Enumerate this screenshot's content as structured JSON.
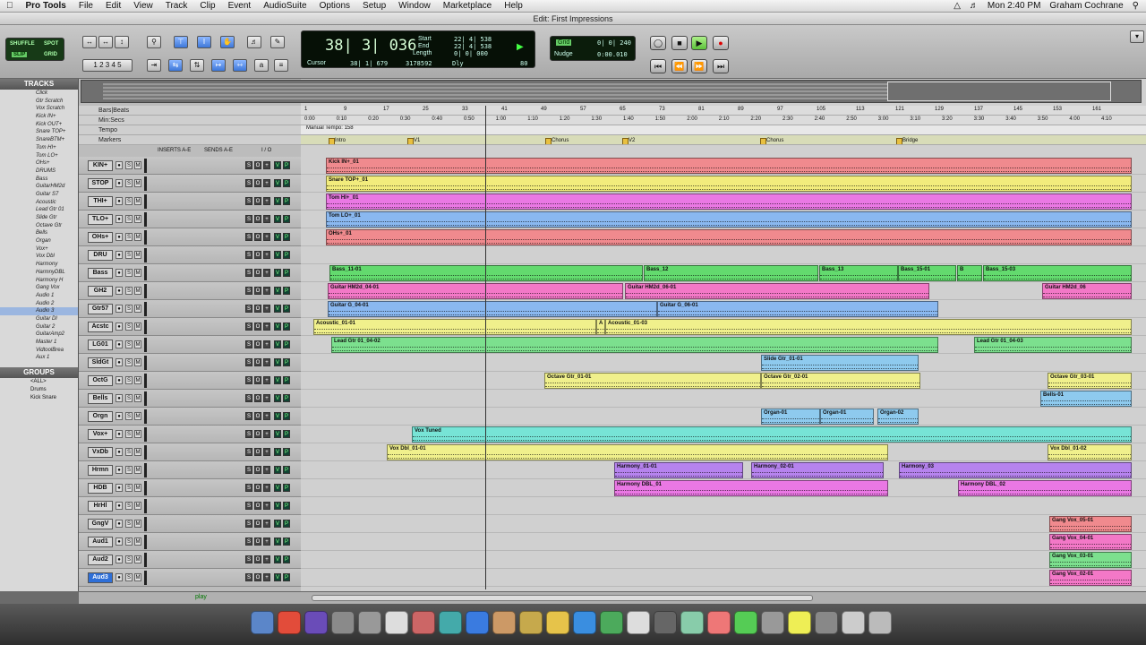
{
  "menubar": {
    "items": [
      "Pro Tools",
      "File",
      "Edit",
      "View",
      "Track",
      "Clip",
      "Event",
      "AudioSuite",
      "Options",
      "Setup",
      "Window",
      "Marketplace",
      "Help"
    ],
    "clock": "Mon 2:40 PM",
    "user": "Graham Cochrane"
  },
  "window": {
    "title": "Edit: First Impressions"
  },
  "mode": {
    "shuffle": "SHUFFLE",
    "spot": "SPOT",
    "slip": "SLIP",
    "grid": "GRID"
  },
  "counter": {
    "main": "38| 3| 036",
    "start_label": "Start",
    "end_label": "End",
    "length_label": "Length",
    "start": "22| 4| 538",
    "end": "22| 4| 538",
    "length": "0| 0| 000",
    "cursor_label": "Cursor",
    "cursor": "38| 1| 679",
    "samples": "3178592",
    "dly": "Dly",
    "tempo": "80"
  },
  "nudge": {
    "grid_label": "Grid",
    "grid": "0| 0| 240",
    "nudge_label": "Nudge",
    "nudge": "0:00.010"
  },
  "panels": {
    "tracks": "TRACKS",
    "groups": "GROUPS"
  },
  "track_list": [
    "Click",
    "Gtr Scratch",
    "Vox Scratch",
    "Kick IN+",
    "Kick OUT+",
    "Snare TOP+",
    "SnareBTM+",
    "Tom HI+",
    "Tom LO+",
    "OHs+",
    "DRUMS",
    "Bass",
    "GuitarHM2d",
    "Guitar S7",
    "Acoustic",
    "Lead Gtr 01",
    "Slide Gtr",
    "Octave Gtr",
    "Bells",
    "Organ",
    "Vox+",
    "Vox Dbl",
    "Harmony",
    "HarmnyDBL",
    "Harmony H",
    "Gang Vox",
    "Audio 1",
    "Audio 2",
    "Audio 3",
    "Guitar Dl",
    "Guitar 2",
    "GuitarAmp2",
    "Master 1",
    "VidtoolBrea",
    "Aux 1"
  ],
  "groups": [
    "<ALL>",
    "Drums",
    "Kick Snare"
  ],
  "ruler_headers": {
    "bars": "Bars|Beats",
    "minsec": "Min:Secs",
    "tempo": "Tempo",
    "markers": "Markers",
    "tempo_val": "Manual Tempo: 158"
  },
  "bars": [
    "1",
    "9",
    "17",
    "25",
    "33",
    "41",
    "49",
    "57",
    "65",
    "73",
    "81",
    "89",
    "97",
    "105",
    "113",
    "121",
    "129",
    "137",
    "145",
    "153",
    "161"
  ],
  "minsecs": [
    "0:00",
    "0:10",
    "0:20",
    "0:30",
    "0:40",
    "0:50",
    "1:00",
    "1:10",
    "1:20",
    "1:30",
    "1:40",
    "1:50",
    "2:00",
    "2:10",
    "2:20",
    "2:30",
    "2:40",
    "2:50",
    "3:00",
    "3:10",
    "3:20",
    "3:30",
    "3:40",
    "3:50",
    "4:00",
    "4:10"
  ],
  "markers": [
    "Intro",
    "V1",
    "Chorus",
    "V2",
    "Chorus",
    "Bridge"
  ],
  "mix_headers": {
    "inserts": "INSERTS A-E",
    "sends": "SENDS A-E",
    "io": "I / O"
  },
  "tracks": [
    {
      "name": "KIN+",
      "clips": [
        {
          "n": "Kick IN+_01",
          "c": "c-red"
        }
      ]
    },
    {
      "name": "STOP",
      "clips": [
        {
          "n": "Snare TOP+_01",
          "c": "c-yel"
        }
      ]
    },
    {
      "name": "THI+",
      "clips": [
        {
          "n": "Tom HI+_01",
          "c": "c-mag"
        }
      ]
    },
    {
      "name": "TLO+",
      "clips": [
        {
          "n": "Tom LO+_01",
          "c": "c-blu"
        }
      ]
    },
    {
      "name": "OHs+",
      "clips": [
        {
          "n": "OHs+_01",
          "c": "c-red"
        }
      ]
    },
    {
      "name": "DRU",
      "clips": []
    },
    {
      "name": "Bass",
      "clips": [
        {
          "n": "Bass_11-01",
          "c": "c-grn"
        },
        {
          "n": "Bass_12",
          "c": "c-grn"
        },
        {
          "n": "Bass_13",
          "c": "c-grn"
        },
        {
          "n": "Bass_15-01",
          "c": "c-grn"
        },
        {
          "n": "B",
          "c": "c-grn"
        },
        {
          "n": "Bass_15-03",
          "c": "c-grn"
        }
      ]
    },
    {
      "name": "GH2",
      "clips": [
        {
          "n": "Guitar HM2d_04-01",
          "c": "c-pnk"
        },
        {
          "n": "Guitar HM2d_06-01",
          "c": "c-pnk"
        },
        {
          "n": "Guitar HM2d_06",
          "c": "c-pnk"
        }
      ]
    },
    {
      "name": "Gtr57",
      "clips": [
        {
          "n": "Guitar G_04-01",
          "c": "c-blu"
        },
        {
          "n": "Guitar G_06-01",
          "c": "c-blu"
        }
      ]
    },
    {
      "name": "Acstc",
      "clips": [
        {
          "n": "Acoustic_01-01",
          "c": "c-lyl"
        },
        {
          "n": "A",
          "c": "c-lyl"
        },
        {
          "n": "Acoustic_01-03",
          "c": "c-lyl"
        }
      ]
    },
    {
      "name": "LG01",
      "clips": [
        {
          "n": "Lead Gtr 01_04-02",
          "c": "c-lgr"
        },
        {
          "n": "Lead Gtr 01_04-03",
          "c": "c-lgr"
        }
      ]
    },
    {
      "name": "SldGt",
      "clips": [
        {
          "n": "Slide Gtr_01-01",
          "c": "c-ltb"
        }
      ]
    },
    {
      "name": "OctG",
      "clips": [
        {
          "n": "Octave Gtr_01-01",
          "c": "c-lyl"
        },
        {
          "n": "Octave Gtr_02-01",
          "c": "c-lyl"
        },
        {
          "n": "Octave Gtr_03-01",
          "c": "c-lyl"
        }
      ]
    },
    {
      "name": "Bells",
      "clips": [
        {
          "n": "Bells-01",
          "c": "c-ltb"
        }
      ]
    },
    {
      "name": "Orgn",
      "clips": [
        {
          "n": "Organ-01",
          "c": "c-ltb"
        },
        {
          "n": "Organ-01",
          "c": "c-ltb"
        },
        {
          "n": "Organ-02",
          "c": "c-ltb"
        }
      ]
    },
    {
      "name": "Vox+",
      "clips": [
        {
          "n": "Vox Tuned",
          "c": "c-cyn"
        }
      ]
    },
    {
      "name": "VxDb",
      "clips": [
        {
          "n": "Vox Dbl_01-01",
          "c": "c-lyl"
        },
        {
          "n": "Vox Dbl_01-02",
          "c": "c-lyl"
        }
      ]
    },
    {
      "name": "Hrmn",
      "clips": [
        {
          "n": "Harmony_01-01",
          "c": "c-pur"
        },
        {
          "n": "Harmony_02-01",
          "c": "c-pur"
        },
        {
          "n": "Harmony_03",
          "c": "c-pur"
        }
      ]
    },
    {
      "name": "HDB",
      "clips": [
        {
          "n": "Harmony DBL_01",
          "c": "c-mag"
        },
        {
          "n": "Harmony DBL_02",
          "c": "c-mag"
        }
      ]
    },
    {
      "name": "HrHl",
      "clips": []
    },
    {
      "name": "GngV",
      "clips": [
        {
          "n": "Gang Vox_05-01",
          "c": "c-red"
        }
      ]
    },
    {
      "name": "Aud1",
      "clips": [
        {
          "n": "Gang Vox_04-01",
          "c": "c-pnk"
        }
      ]
    },
    {
      "name": "Aud2",
      "clips": [
        {
          "n": "Gang Vox_03-01",
          "c": "c-lgr"
        }
      ]
    },
    {
      "name": "Aud3",
      "clips": [
        {
          "n": "Gang Vox_02-01",
          "c": "c-pnk"
        }
      ]
    }
  ],
  "status": {
    "play": "play"
  }
}
